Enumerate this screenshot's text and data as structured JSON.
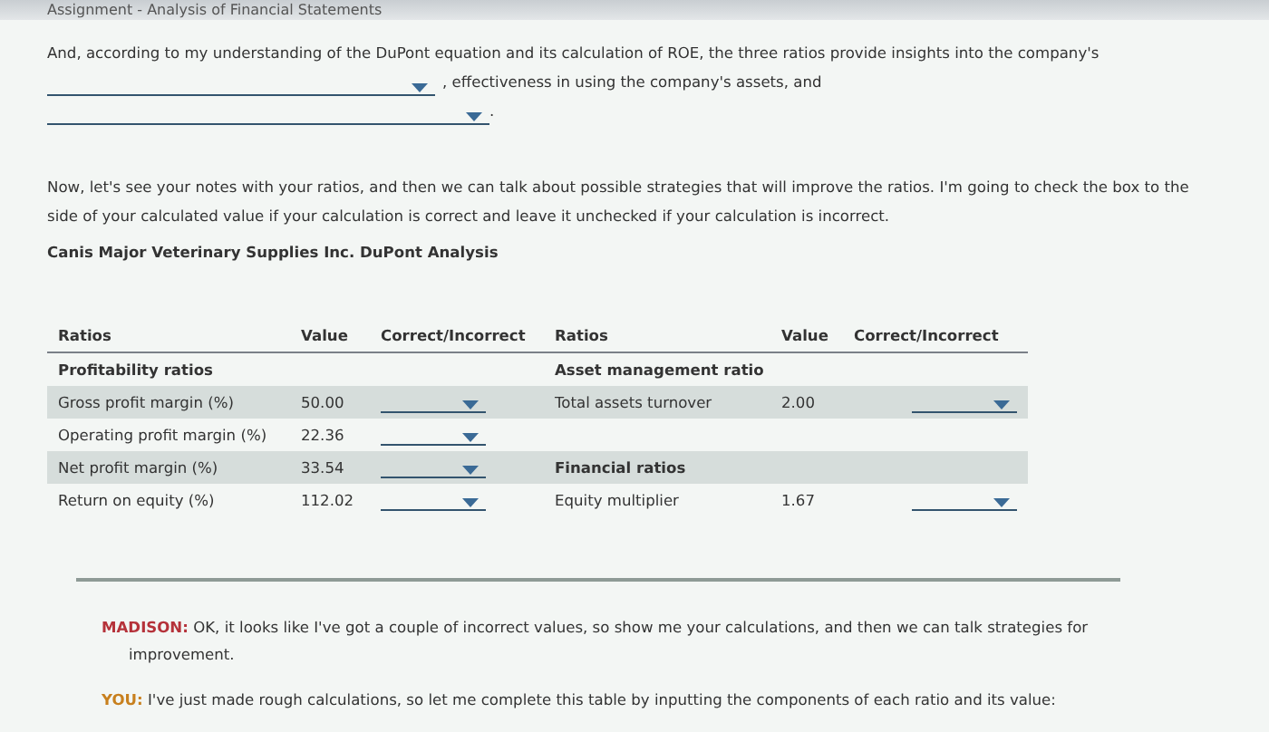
{
  "window": {
    "title": "Assignment - Analysis of Financial Statements"
  },
  "intro_sentence": [
    {
      "kind": "text",
      "text": "And, according to my understanding of the DuPont equation and its calculation of ROE, the three ratios provide insights into the company's"
    },
    {
      "kind": "dropdown"
    },
    {
      "kind": "text",
      "text": ", effectiveness in using the company's assets, and"
    },
    {
      "kind": "dropdown"
    },
    {
      "kind": "text",
      "text": "."
    }
  ],
  "notes_paragraph": "Now, let's see your notes with your ratios, and then we can talk about possible strategies that will improve the ratios. I'm going to check the box to the side of your calculated value if your calculation is correct and leave it unchecked if your calculation is incorrect.",
  "table": {
    "title": "Canis Major Veterinary Supplies Inc. DuPont Analysis",
    "columns": [
      "Ratios",
      "Value",
      "Correct/Incorrect",
      "Ratios",
      "Value",
      "Correct/Incorrect"
    ],
    "rows": [
      {
        "shaded": false,
        "left": {
          "kind": "section",
          "label": "Profitability ratios"
        },
        "right": {
          "kind": "section",
          "label": "Asset management ratio"
        }
      },
      {
        "shaded": true,
        "left": {
          "kind": "ratio",
          "label": "Gross profit margin (%)",
          "value": "50.00"
        },
        "right": {
          "kind": "ratio",
          "label": "Total assets turnover",
          "value": "2.00"
        }
      },
      {
        "shaded": false,
        "left": {
          "kind": "ratio",
          "label": "Operating profit margin (%)",
          "value": "22.36"
        },
        "right": {
          "kind": "empty"
        }
      },
      {
        "shaded": true,
        "left": {
          "kind": "ratio",
          "label": "Net profit margin (%)",
          "value": "33.54"
        },
        "right": {
          "kind": "section",
          "label": "Financial ratios"
        }
      },
      {
        "shaded": false,
        "left": {
          "kind": "ratio",
          "label": "Return on equity (%)",
          "value": "112.02"
        },
        "right": {
          "kind": "ratio",
          "label": "Equity multiplier",
          "value": "1.67"
        }
      }
    ]
  },
  "dialog": [
    {
      "speaker": "MADISON:",
      "color": "#b5323a",
      "text": "OK, it looks like I've got a couple of incorrect values, so show me your calculations, and then we can talk strategies for improvement."
    },
    {
      "speaker": "YOU:",
      "color": "#c8801e",
      "text": "I've just made rough calculations, so let me complete this table by inputting the components of each ratio and its value:"
    }
  ]
}
